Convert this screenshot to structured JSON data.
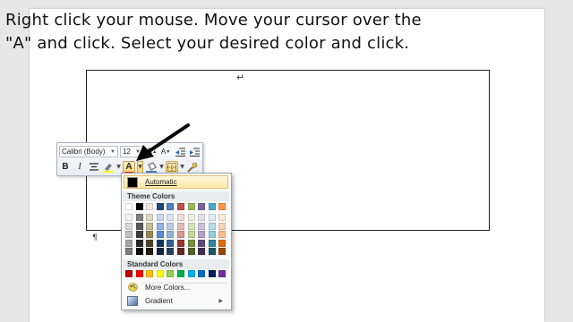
{
  "instruction": {
    "line1": "Right click your mouse. Move your cursor over the",
    "line2": "\"A\" and click. Select your desired color and click."
  },
  "document": {
    "return_mark": "↵",
    "paragraph_mark": "¶"
  },
  "mini_toolbar": {
    "font_name": "Calibri (Body)",
    "font_size": "12",
    "bold": "B",
    "italic": "I",
    "font_color_letter": "A",
    "grow_font": "A",
    "shrink_font": "A",
    "font_color_bar": "#e8231b"
  },
  "color_menu": {
    "automatic_label": "Automatic",
    "theme_colors_label": "Theme Colors",
    "standard_colors_label": "Standard Colors",
    "more_colors_label": "More Colors...",
    "gradient_label": "Gradient",
    "theme_top_row": [
      "#ffffff",
      "#000000",
      "#eeece1",
      "#1f497d",
      "#4f81bd",
      "#c0504d",
      "#9bbb59",
      "#8064a2",
      "#4bacc6",
      "#f79646"
    ],
    "theme_shades": [
      [
        "#f2f2f2",
        "#7f7f7f",
        "#ddd9c3",
        "#c6d9f0",
        "#dbe5f1",
        "#f2dcdb",
        "#ebf1dd",
        "#e5e0ec",
        "#dbeef3",
        "#fdeada"
      ],
      [
        "#d8d8d8",
        "#595959",
        "#c4bd97",
        "#8db3e2",
        "#b8cce4",
        "#e5b9b7",
        "#d7e3bc",
        "#ccc1d9",
        "#b7dde8",
        "#fbd5b5"
      ],
      [
        "#bfbfbf",
        "#3f3f3f",
        "#938953",
        "#548dd4",
        "#95b3d7",
        "#d99694",
        "#c3d69b",
        "#b2a2c7",
        "#92cddc",
        "#fac08f"
      ],
      [
        "#a5a5a5",
        "#262626",
        "#494429",
        "#17365d",
        "#366092",
        "#953734",
        "#76923c",
        "#5f497a",
        "#31859b",
        "#e36c09"
      ],
      [
        "#7f7f7f",
        "#0c0c0c",
        "#1d1b10",
        "#0f243e",
        "#244061",
        "#632423",
        "#4f6128",
        "#3f3151",
        "#205867",
        "#974806"
      ]
    ],
    "standard": [
      "#c00000",
      "#ff0000",
      "#ffc000",
      "#ffff00",
      "#92d050",
      "#00b050",
      "#00b0f0",
      "#0070c0",
      "#002060",
      "#7030a0"
    ]
  }
}
